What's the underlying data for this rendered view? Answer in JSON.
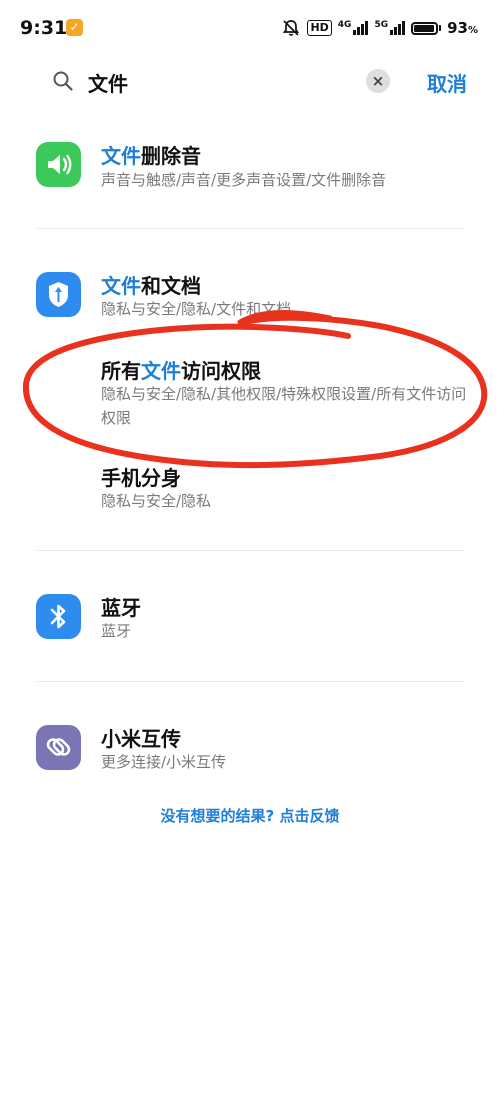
{
  "status_bar": {
    "time": "9:31",
    "hd_label": "HD",
    "net1": "4G",
    "net2": "5G",
    "battery_level": 0.93,
    "battery_pct": "93",
    "battery_unit": "%"
  },
  "search": {
    "query": "文件",
    "cancel_label": "取消",
    "clear_icon": "clear-icon"
  },
  "results": [
    {
      "title_hl": "文件",
      "title_rest": "删除音",
      "path": "声音与触感/声音/更多声音设置/文件删除音",
      "icon": "speaker-icon",
      "icon_color": "#3dc95a"
    },
    {
      "title_hl": "文件",
      "title_rest": "和文档",
      "path": "隐私与安全/隐私/文件和文档",
      "icon": "shield-icon",
      "icon_color": "#2f8cef"
    },
    {
      "title_pre": "所有",
      "title_hl": "文件",
      "title_rest": "访问权限",
      "path": "隐私与安全/隐私/其他权限/特殊权限设置/所有文件访问权限"
    },
    {
      "title": "手机分身",
      "path": "隐私与安全/隐私"
    },
    {
      "title": "蓝牙",
      "path": "蓝牙",
      "icon": "bluetooth-icon",
      "icon_color": "#2f8cef"
    },
    {
      "title": "小米互传",
      "path": "更多连接/小米互传",
      "icon": "link-icon",
      "icon_color": "#7b75b5"
    }
  ],
  "feedback": "没有想要的结果? 点击反馈",
  "annotation_color": "#e8321e"
}
